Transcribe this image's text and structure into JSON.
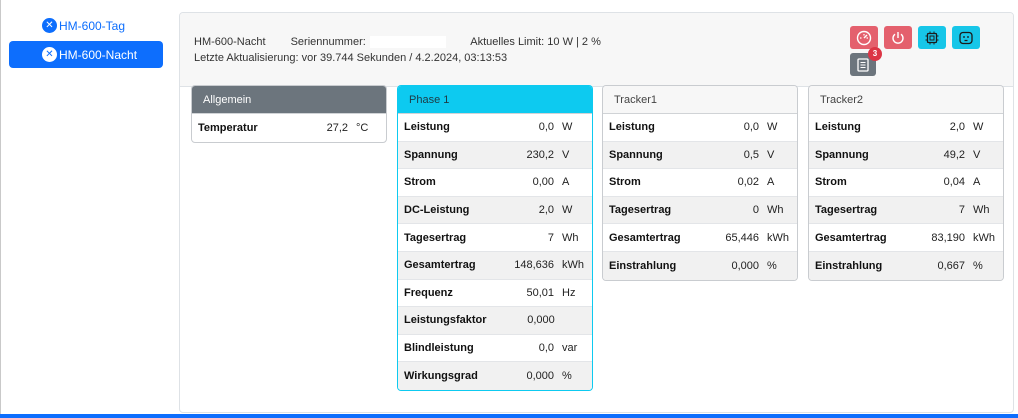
{
  "tabs": [
    {
      "label": "HM-600-Tag",
      "active": false
    },
    {
      "label": "HM-600-Nacht",
      "active": true
    }
  ],
  "header": {
    "device": "HM-600-Nacht",
    "serial_label": "Seriennummer:",
    "limit": "Aktuelles Limit: 10 W | 2 %",
    "last_update": "Letzte Aktualisierung: vor 39.744 Sekunden / 4.2.2024, 03:13:53",
    "event_badge": "3"
  },
  "buttons": {
    "colors": {
      "red": "#e4606d",
      "cyan": "#17c6e8",
      "gray": "#6c757d"
    },
    "icons": [
      "speedometer-icon",
      "power-icon",
      "cpu-icon",
      "outlet-icon",
      "list-icon"
    ]
  },
  "general": {
    "title": "Allgemein",
    "rows": [
      {
        "name": "Temperatur",
        "value": "27,2",
        "unit": "°C"
      }
    ]
  },
  "phase": {
    "title": "Phase 1",
    "rows": [
      {
        "name": "Leistung",
        "value": "0,0",
        "unit": "W"
      },
      {
        "name": "Spannung",
        "value": "230,2",
        "unit": "V"
      },
      {
        "name": "Strom",
        "value": "0,00",
        "unit": "A"
      },
      {
        "name": "DC-Leistung",
        "value": "2,0",
        "unit": "W"
      },
      {
        "name": "Tagesertrag",
        "value": "7",
        "unit": "Wh"
      },
      {
        "name": "Gesamtertrag",
        "value": "148,636",
        "unit": "kWh"
      },
      {
        "name": "Frequenz",
        "value": "50,01",
        "unit": "Hz"
      },
      {
        "name": "Leistungsfaktor",
        "value": "0,000",
        "unit": ""
      },
      {
        "name": "Blindleistung",
        "value": "0,0",
        "unit": "var"
      },
      {
        "name": "Wirkungsgrad",
        "value": "0,000",
        "unit": "%"
      }
    ]
  },
  "tracker1": {
    "title": "Tracker1",
    "rows": [
      {
        "name": "Leistung",
        "value": "0,0",
        "unit": "W"
      },
      {
        "name": "Spannung",
        "value": "0,5",
        "unit": "V"
      },
      {
        "name": "Strom",
        "value": "0,02",
        "unit": "A"
      },
      {
        "name": "Tagesertrag",
        "value": "0",
        "unit": "Wh"
      },
      {
        "name": "Gesamtertrag",
        "value": "65,446",
        "unit": "kWh"
      },
      {
        "name": "Einstrahlung",
        "value": "0,000",
        "unit": "%"
      }
    ]
  },
  "tracker2": {
    "title": "Tracker2",
    "rows": [
      {
        "name": "Leistung",
        "value": "2,0",
        "unit": "W"
      },
      {
        "name": "Spannung",
        "value": "49,2",
        "unit": "V"
      },
      {
        "name": "Strom",
        "value": "0,04",
        "unit": "A"
      },
      {
        "name": "Tagesertrag",
        "value": "7",
        "unit": "Wh"
      },
      {
        "name": "Gesamtertrag",
        "value": "83,190",
        "unit": "kWh"
      },
      {
        "name": "Einstrahlung",
        "value": "0,667",
        "unit": "%"
      }
    ]
  }
}
